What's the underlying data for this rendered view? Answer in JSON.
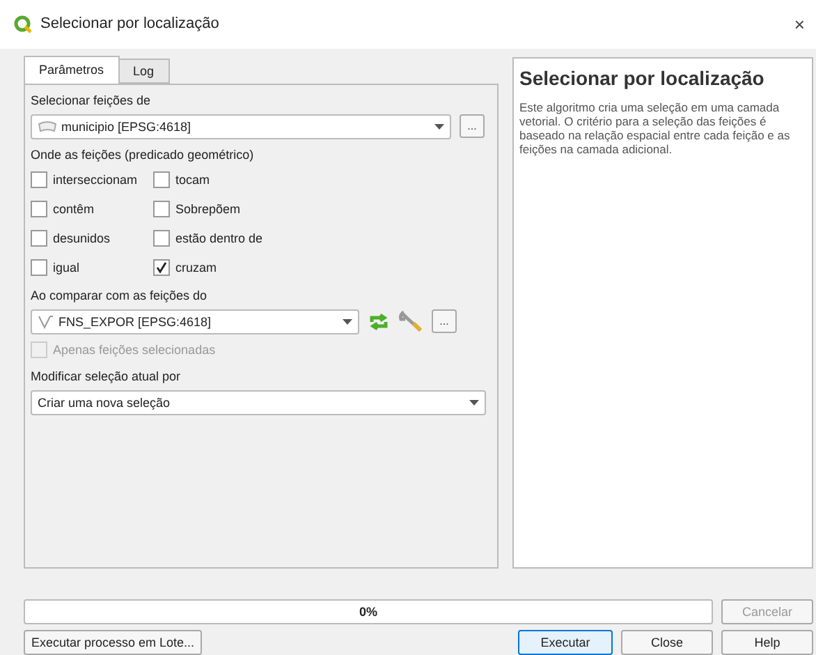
{
  "window": {
    "title": "Selecionar por localização",
    "close": "×"
  },
  "tabs": [
    {
      "label": "Parâmetros",
      "selected": true
    },
    {
      "label": "Log",
      "selected": false
    }
  ],
  "source": {
    "label": "Selecionar feições de",
    "value": "municipio [EPSG:4618]",
    "more": "..."
  },
  "predicate": {
    "label": "Onde as feições (predicado geométrico)",
    "options": [
      {
        "label": "interseccionam",
        "checked": false
      },
      {
        "label": "tocam",
        "checked": false
      },
      {
        "label": "contêm",
        "checked": false
      },
      {
        "label": "Sobrepõem",
        "checked": false
      },
      {
        "label": "desunidos",
        "checked": false
      },
      {
        "label": "estão dentro de",
        "checked": false
      },
      {
        "label": "igual",
        "checked": false
      },
      {
        "label": "cruzam",
        "checked": true
      }
    ]
  },
  "compare": {
    "label": "Ao comparar com as feições do",
    "value": "FNS_EXPOR [EPSG:4618]",
    "more": "...",
    "selected_only": {
      "label": "Apenas feições selecionadas",
      "checked": false,
      "disabled": true
    }
  },
  "modify": {
    "label": "Modificar seleção atual por",
    "value": "Criar uma nova seleção"
  },
  "help": {
    "title": "Selecionar por localização",
    "text": "Este algoritmo cria uma seleção em uma camada vetorial. O critério para a seleção das feições é baseado na relação espacial entre cada feição e as feições na camada adicional."
  },
  "progress": {
    "level": 0,
    "reading": "0%"
  },
  "buttons": [
    {
      "label": "Cancelar",
      "disabled": true
    },
    {
      "label": "Executar processo em Lote...",
      "disabled": false
    },
    {
      "label": "Executar",
      "disabled": false,
      "default": true
    },
    {
      "label": "Close",
      "disabled": false
    },
    {
      "label": "Help",
      "disabled": false
    }
  ]
}
